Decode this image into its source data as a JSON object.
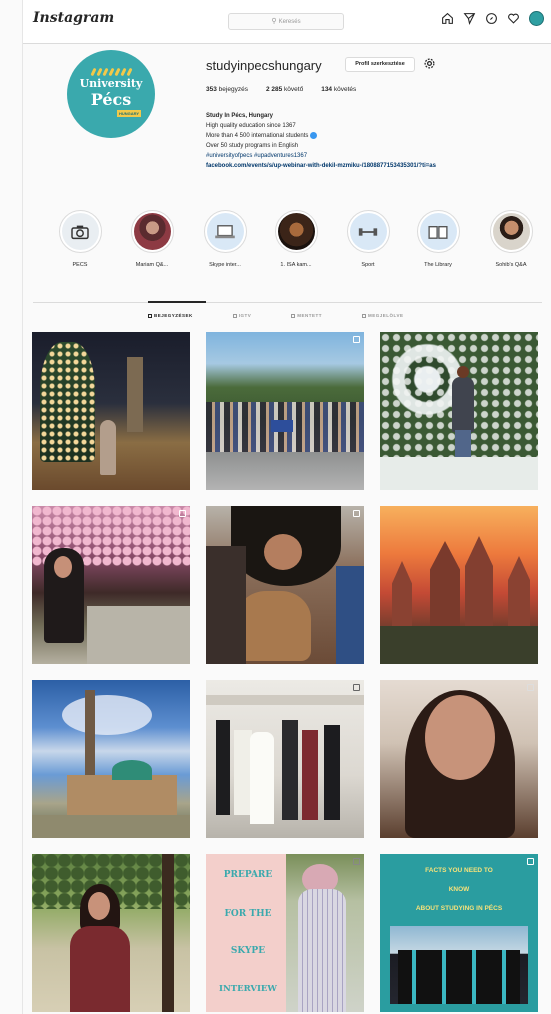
{
  "app": {
    "logo": "Instagram",
    "search_placeholder": "Keresés"
  },
  "profile": {
    "username": "studyinpecshungary",
    "edit_button": "Profil szerkesztése",
    "avatar": {
      "line1": "University",
      "line2": "Pécs",
      "badge": "HUNGARY"
    },
    "stats": {
      "posts_count": "353",
      "posts_label": "bejegyzés",
      "followers_count": "2 285",
      "followers_label": "követő",
      "following_count": "134",
      "following_label": "követés"
    },
    "bio": {
      "name": "Study In Pécs, Hungary",
      "line1": "High quality education since 1367",
      "line2": "More than 4 500 international students",
      "line3": "Over 50 study programs in English",
      "hashtags": "#universityofpecs #upadventures1367",
      "link": "facebook.com/events/s/up-webinar-with-dekil-mzmiku-/1808877153435301/?ti=as"
    }
  },
  "highlights": [
    {
      "label": "PÉCS",
      "icon": "camera-icon"
    },
    {
      "label": "Mariam Q&...",
      "icon": "photo"
    },
    {
      "label": "Skype inter...",
      "icon": "laptop-icon"
    },
    {
      "label": "1. ISA kam...",
      "icon": "photo"
    },
    {
      "label": "Sport",
      "icon": "dumbbell-icon"
    },
    {
      "label": "The Library",
      "icon": "book-icon"
    },
    {
      "label": "Sohib's Q&A",
      "icon": "photo"
    }
  ],
  "tabs": [
    {
      "label": "BEJEGYZÉSEK",
      "active": true
    },
    {
      "label": "IGTV",
      "active": false
    },
    {
      "label": "MENTETT",
      "active": false
    },
    {
      "label": "MEGJELÖLVE",
      "active": false
    }
  ],
  "posts_text": {
    "skype": [
      "PREPARE",
      "FOR THE",
      "SKYPE",
      "INTERVIEW"
    ],
    "facts": [
      "FACTS YOU NEED TO",
      "KNOW",
      "ABOUT STUDYING IN PÉCS"
    ]
  },
  "colors": {
    "accent": "#3aa9ad",
    "link": "#00376b",
    "border": "#dbdbdb"
  }
}
